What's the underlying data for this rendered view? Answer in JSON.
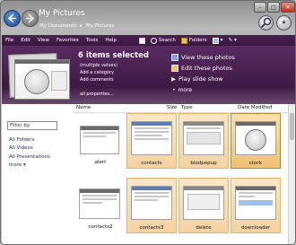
{
  "window": {
    "title": "My Pictures",
    "breadcrumbs": [
      "My Documents",
      "My Pictures"
    ],
    "controls": [
      "minimize-icon",
      "maximize-icon",
      "close-icon"
    ]
  },
  "menu": {
    "items": [
      "File",
      "Edit",
      "View",
      "Favorites",
      "Tools",
      "Help"
    ],
    "search_label": "Search",
    "folders_label": "Folders"
  },
  "preview": {
    "selected_title": "6 items selected",
    "lines": [
      "(multiple values)",
      "Add a category",
      "Add comments"
    ],
    "properties_link": "all properties...",
    "tasks": [
      "View these photos",
      "Edit these photos",
      "Play slide show"
    ],
    "more": "more"
  },
  "sidebar": {
    "filter_placeholder": "Filter by",
    "links": [
      "All Folders",
      "All Videos",
      "All Presentations"
    ],
    "more": "more"
  },
  "columns": [
    "Name",
    "Size",
    "Type",
    "Date Modified"
  ],
  "files": [
    {
      "name": "alert",
      "selected": false
    },
    {
      "name": "contacts",
      "selected": true
    },
    {
      "name": "blodpopup",
      "selected": true
    },
    {
      "name": "clock",
      "selected": true
    },
    {
      "name": "contacts2",
      "selected": false
    },
    {
      "name": "contacts3",
      "selected": true
    },
    {
      "name": "delete",
      "selected": true
    },
    {
      "name": "downloader",
      "selected": true
    }
  ],
  "colors": {
    "accent_dark": "#3a1840",
    "selection": "#f5d2a0"
  }
}
